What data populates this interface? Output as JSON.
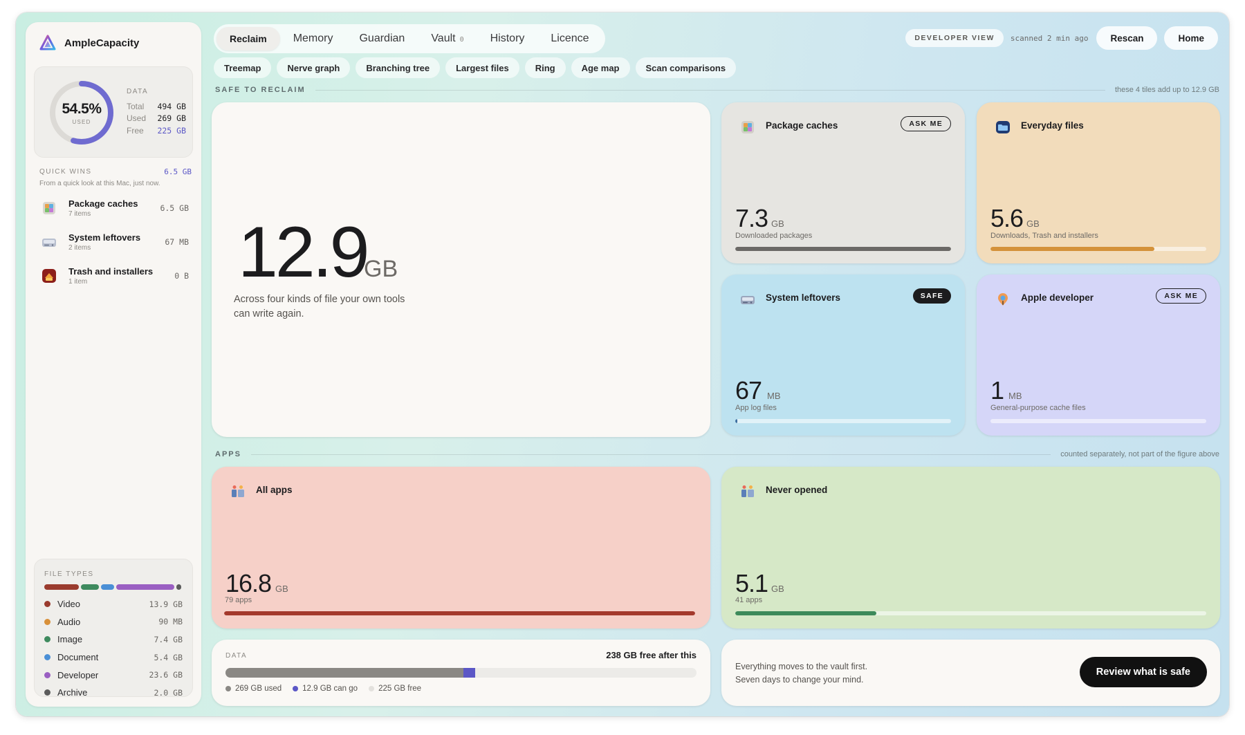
{
  "app": {
    "name": "AmpleCapacity"
  },
  "sidebar": {
    "data_box": {
      "percent": "54.5%",
      "percent_value": 54.5,
      "used_caption": "USED",
      "label": "DATA",
      "rows": [
        {
          "key": "Total",
          "value": "494 GB"
        },
        {
          "key": "Used",
          "value": "269 GB"
        },
        {
          "key": "Free",
          "value": "225 GB"
        }
      ]
    },
    "quick_wins": {
      "title": "QUICK WINS",
      "total": "6.5 GB",
      "subtitle": "From a quick look at this Mac, just now.",
      "items": [
        {
          "name": "Package caches",
          "count": "7 items",
          "size": "6.5 GB",
          "icon": "package-icon"
        },
        {
          "name": "System leftovers",
          "count": "2 items",
          "size": "67 MB",
          "icon": "drive-icon"
        },
        {
          "name": "Trash and installers",
          "count": "1 item",
          "size": "0 B",
          "icon": "trash-icon"
        }
      ]
    },
    "file_types": {
      "title": "FILE TYPES",
      "items": [
        {
          "name": "Video",
          "size": "13.9 GB",
          "color": "#9a3b2e"
        },
        {
          "name": "Audio",
          "size": "90 MB",
          "color": "#d8903a"
        },
        {
          "name": "Image",
          "size": "7.4 GB",
          "color": "#3e8a5e"
        },
        {
          "name": "Document",
          "size": "5.4 GB",
          "color": "#4a8fd6"
        },
        {
          "name": "Developer",
          "size": "23.6 GB",
          "color": "#9a5fc2"
        },
        {
          "name": "Archive",
          "size": "2.0 GB",
          "color": "#5c5c5c"
        }
      ]
    }
  },
  "nav": {
    "tabs": [
      {
        "label": "Reclaim",
        "active": true
      },
      {
        "label": "Memory"
      },
      {
        "label": "Guardian"
      },
      {
        "label": "Vault",
        "badge": "0"
      },
      {
        "label": "History"
      },
      {
        "label": "Licence"
      }
    ],
    "developer_view": "DEVELOPER VIEW",
    "scanned": "scanned 2 min ago",
    "rescan": "Rescan",
    "home": "Home",
    "subtabs": [
      "Treemap",
      "Nerve graph",
      "Branching tree",
      "Largest files",
      "Ring",
      "Age map",
      "Scan comparisons"
    ]
  },
  "reclaim": {
    "title": "SAFE TO RECLAIM",
    "note": "these 4 tiles add up to 12.9 GB",
    "hero": {
      "value": "12.9",
      "unit": "GB",
      "description": "Across four kinds of file your own tools can write again."
    },
    "tiles": [
      {
        "name": "Package caches",
        "tag": "ASK ME",
        "value": "7.3",
        "unit": "GB",
        "sub": "Downloaded packages",
        "fill": 1.0,
        "bar_color": "#6b6966",
        "icon": "package-icon"
      },
      {
        "name": "Everyday files",
        "tag": "",
        "value": "5.6",
        "unit": "GB",
        "sub": "Downloads, Trash and installers",
        "fill": 0.76,
        "bar_color": "#d4923a",
        "icon": "folder-icon"
      },
      {
        "name": "System leftovers",
        "tag": "SAFE",
        "value": "67",
        "unit": "MB",
        "sub": "App log files",
        "fill": 0.01,
        "bar_color": "#3d6fa0",
        "icon": "drive-icon"
      },
      {
        "name": "Apple developer",
        "tag": "ASK ME",
        "value": "1",
        "unit": "MB",
        "sub": "General-purpose cache files",
        "fill": 0.0,
        "bar_color": "#5b57c6",
        "icon": "hammer-icon"
      }
    ]
  },
  "apps": {
    "title": "APPS",
    "note": "counted separately, not part of the figure above",
    "cards": [
      {
        "name": "All apps",
        "value": "16.8",
        "unit": "GB",
        "sub": "79 apps",
        "fill": 1.0,
        "bar_color": "#a4392c",
        "icon": "apps-icon"
      },
      {
        "name": "Never opened",
        "value": "5.1",
        "unit": "GB",
        "sub": "41 apps",
        "fill": 0.3,
        "bar_color": "#3d8a5a",
        "icon": "apps-icon"
      }
    ]
  },
  "bottom": {
    "data_label": "DATA",
    "free_after": "238 GB free after this",
    "bar": {
      "used": 269,
      "can_go": 12.9,
      "free": 225
    },
    "legend": [
      {
        "label": "269 GB used",
        "color": "#8a8884"
      },
      {
        "label": "12.9 GB can go",
        "color": "#5b57c6"
      },
      {
        "label": "225 GB free",
        "color": "#e3e1dd"
      }
    ],
    "vault_message_1": "Everything moves to the vault first.",
    "vault_message_2": "Seven days to change your mind.",
    "review_button": "Review what is safe"
  },
  "colors": {
    "accent": "#5b57c6",
    "used_bar": "#8a8884"
  }
}
